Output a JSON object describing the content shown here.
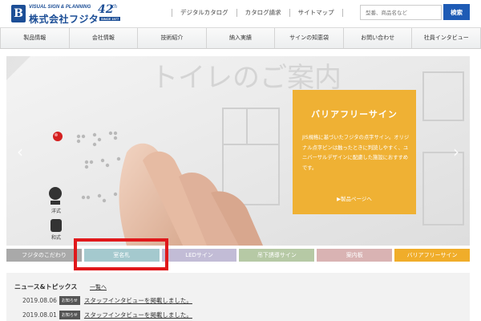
{
  "header": {
    "logo_tagline": "VISUAL SIGN & PLANNING",
    "logo_name": "株式会社フジタ",
    "anniversary_number": "42",
    "anniversary_suffix": "th",
    "anniversary_since": "SINCE 1977",
    "top_links": [
      "デジタルカタログ",
      "カタログ請求",
      "サイトマップ"
    ],
    "search_placeholder": "型番、商品名など",
    "search_button": "検索"
  },
  "nav": {
    "items": [
      "製品情報",
      "会社情報",
      "技術紹介",
      "納入実績",
      "サインの知恵袋",
      "お問い合わせ",
      "社員インタビュー"
    ]
  },
  "hero": {
    "caption_title": "バリアフリーサイン",
    "caption_body": "JIS規格に基づいたフジタの点字サイン。オリジナル点字ピンは触ったときに判読しやすく、ユニバーサルデザインに配慮した施設におすすめです。",
    "caption_link": "▶製品ページへ",
    "wall_text": "トイレのご案内",
    "label_western": "洋式",
    "label_japanese": "和式",
    "prev_arrow": "‹",
    "next_arrow": "›"
  },
  "category_tabs": [
    {
      "label": "フジタのこだわり",
      "color": "#a9a9a9"
    },
    {
      "label": "室名札",
      "color": "#a4c9ce"
    },
    {
      "label": "LEDサイン",
      "color": "#c2bcd6"
    },
    {
      "label": "吊下誘導サイン",
      "color": "#b6c9a5"
    },
    {
      "label": "案内板",
      "color": "#d9b3b3"
    },
    {
      "label": "バリアフリーサイン",
      "color": "#f0ad2a"
    }
  ],
  "news": {
    "title": "ニュース&トピックス",
    "all_link": "一覧へ",
    "items": [
      {
        "date": "2019.08.06",
        "badge": "お知らせ",
        "text": "スタッフインタビューを掲載しました。"
      },
      {
        "date": "2019.08.01",
        "badge": "お知らせ",
        "text": "スタッフインタビューを掲載しました。"
      }
    ]
  },
  "colors": {
    "brand_blue": "#1c4e96",
    "search_button": "#1e5bb5",
    "highlight": "#e0181b",
    "caption_bg": "#efad28"
  }
}
